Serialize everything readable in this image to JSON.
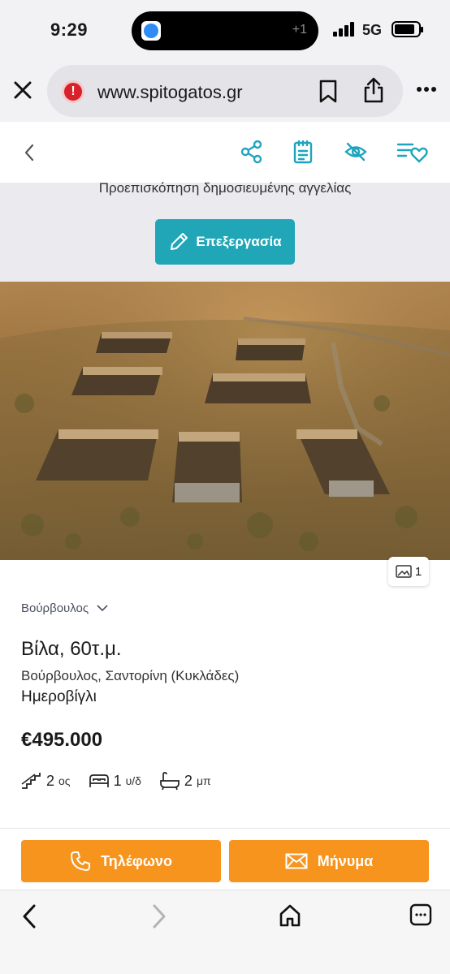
{
  "status_bar": {
    "time": "9:29",
    "island_count": "+1",
    "network": "5G"
  },
  "browser": {
    "url": "www.spitogatos.gr",
    "icons": [
      "close-icon",
      "site-warning-icon",
      "bookmark-icon",
      "share-icon",
      "more-icon"
    ]
  },
  "toolbar": {
    "icons": [
      "back-chevron-icon",
      "share-nodes-icon",
      "notes-icon",
      "hide-eye-icon",
      "favorite-list-icon"
    ]
  },
  "promo": {
    "text": "Προεπισκόπηση δημοσιευμένης αγγελίας",
    "edit_label": "Επεξεργασία"
  },
  "photo": {
    "count": "1"
  },
  "listing": {
    "location_select": "Βούρβουλος",
    "title": "Βίλα, 60τ.μ.",
    "address": "Βούρβουλος, Σαντορίνη (Κυκλάδες)",
    "area": "Ημεροβίγλι",
    "price": "€495.000",
    "features": [
      {
        "icon": "stairs-icon",
        "value": "2",
        "unit": "ος"
      },
      {
        "icon": "bed-icon",
        "value": "1",
        "unit": "υ/δ"
      },
      {
        "icon": "bathtub-icon",
        "value": "2",
        "unit": "μπ"
      }
    ]
  },
  "actions": {
    "phone_label": "Τηλέφωνο",
    "message_label": "Μήνυμα",
    "color": "#f7941d"
  },
  "bottom_bar": {
    "icons": [
      "back-icon",
      "forward-icon",
      "home-icon",
      "tabs-icon"
    ]
  }
}
